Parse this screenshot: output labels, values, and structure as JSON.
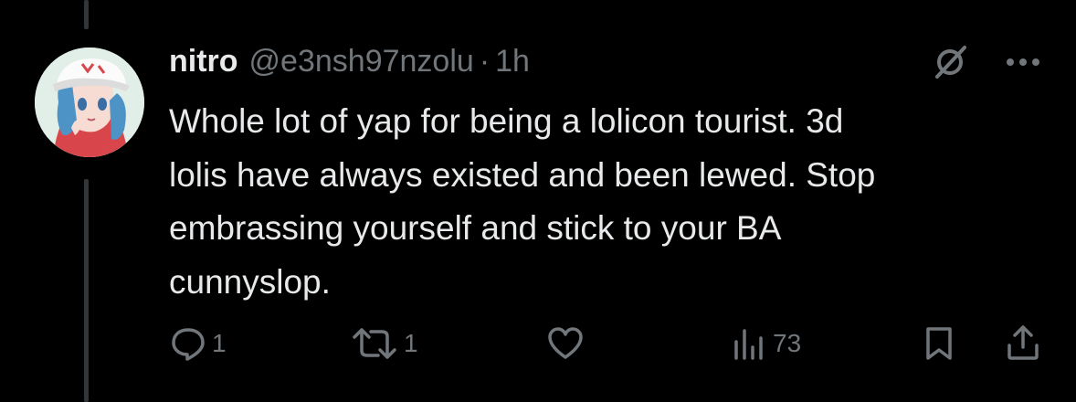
{
  "tweet": {
    "display_name": "nitro",
    "handle": "@e3nsh97nzolu",
    "separator": "·",
    "time": "1h",
    "text_lines": [
      "Whole lot of yap for being a lolicon tourist. 3d",
      "lolis have always existed and been lewed. Stop",
      "embrassing yourself and stick to your BA",
      "cunnyslop."
    ]
  },
  "actions": {
    "reply_count": "1",
    "repost_count": "1",
    "like_count": "",
    "views_count": "73"
  },
  "icons": {
    "avatar": "avatar",
    "grok": "grok-icon",
    "more": "more-icon",
    "reply": "reply-icon",
    "repost": "repost-icon",
    "like": "like-icon",
    "views": "views-icon",
    "bookmark": "bookmark-icon",
    "share": "share-icon"
  },
  "colors": {
    "background": "#000000",
    "text": "#e7e9ea",
    "secondary": "#71767b",
    "thread_line": "#333639"
  }
}
